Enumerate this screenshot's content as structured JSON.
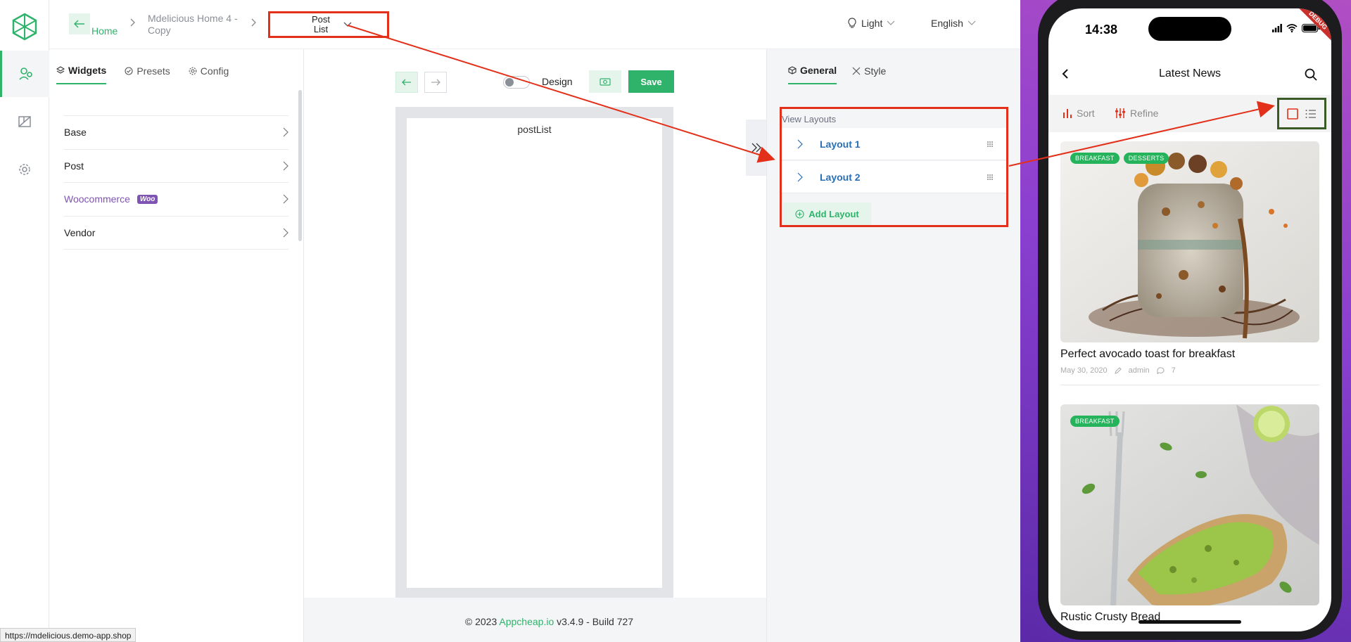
{
  "header": {
    "home_label": "Home",
    "project_name": "Mdelicious Home 4 - Copy",
    "current_screen": "Post List",
    "theme": "Light",
    "language": "English"
  },
  "widgets_panel": {
    "tabs": [
      {
        "label": "Widgets",
        "icon": "layers-icon"
      },
      {
        "label": "Presets",
        "icon": "check-circle-icon"
      },
      {
        "label": "Config",
        "icon": "gear-icon"
      }
    ],
    "items": [
      {
        "label": "Base"
      },
      {
        "label": "Post"
      },
      {
        "label": "Woocommerce",
        "badge": "Woo"
      },
      {
        "label": "Vendor"
      }
    ]
  },
  "canvas": {
    "design_label": "Design",
    "save_label": "Save",
    "screen_label": "postList"
  },
  "footer": {
    "copyright": "© 2023",
    "brand": "Appcheap.io",
    "version": "v3.4.9 - Build 727"
  },
  "settings_panel": {
    "tabs": [
      {
        "label": "General",
        "icon": "cube-icon"
      },
      {
        "label": "Style",
        "icon": "tools-icon"
      }
    ],
    "section_title": "View Layouts",
    "layouts": [
      {
        "label": "Layout 1"
      },
      {
        "label": "Layout 2"
      }
    ],
    "add_layout_label": "Add Layout"
  },
  "status_url": "https://mdelicious.demo-app.shop",
  "phone": {
    "time": "14:38",
    "debug_label": "DEBUG",
    "title": "Latest News",
    "sort_label": "Sort",
    "refine_label": "Refine",
    "posts": [
      {
        "tags": [
          "BREAKFAST",
          "DESSERTS"
        ],
        "title": "Perfect avocado toast for breakfast",
        "date": "May 30, 2020",
        "author": "admin",
        "comments": "7"
      },
      {
        "tags": [
          "BREAKFAST"
        ],
        "title": "Rustic Crusty Bread"
      }
    ]
  },
  "colors": {
    "accent": "#2fb36b",
    "highlight": "#e2301a",
    "link": "#2a6fb5",
    "woo": "#7f54b3"
  }
}
